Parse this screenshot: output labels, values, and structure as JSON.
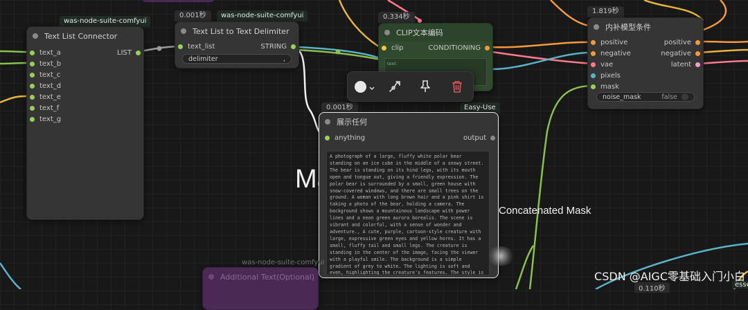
{
  "nodes": {
    "text_list_connector": {
      "suite_tag": "was-node-suite-comfyui",
      "title": "Text List Connector",
      "inputs": [
        "text_a",
        "text_b",
        "text_c",
        "text_d",
        "text_e",
        "text_f",
        "text_g"
      ],
      "output": "LIST"
    },
    "text_list_to_delimiter": {
      "time": "0.001秒",
      "suite_tag": "was-node-suite-comfyui",
      "title": "Text List to Text Delimiter",
      "input": "text_list",
      "output": "STRING",
      "widget_label": "delimiter",
      "widget_value": ","
    },
    "clip_text_encode": {
      "time": "0.334秒",
      "title": "CLIP文本编码",
      "input": "clip",
      "output": "CONDITIONING",
      "text_preview": "text"
    },
    "inpaint_conditioning": {
      "time": "1.819秒",
      "title": "内补模型条件",
      "inputs": [
        "positive",
        "negative",
        "vae",
        "pixels",
        "mask"
      ],
      "outputs": [
        "positive",
        "negative",
        "latent"
      ],
      "widget_label": "noise_mask",
      "widget_value": "false"
    },
    "show_any": {
      "time": "0.001秒",
      "suite_tag": "Easy-Use",
      "title": "展示任何",
      "input": "anything",
      "output": "output",
      "text": "A photograph of a large, fluffy white polar bear standing on an ice cube in the middle of a snowy street. The bear is standing on its hind legs, with its mouth open and tongue out, giving a friendly expression. The polar bear is surrounded by a small, green house with snow-covered windows, and there are small trees on the ground. A woman with long brown hair and a pink shirt is taking a photo of the bear, holding a camera. The background shows a mountainous landscape with power lines and a neon green aurora borealis. The scene is vibrant and colorful, with a sense of wonder and adventure., A cute, purple, cartoon-style creature with large, expressive green eyes and yellow horns. It has a small, fluffy tail and small legs. The creature is standing in the center of the image, facing the viewer with a playful smile. The background is a simple gradient of grey to white. The lighting is soft and even, highlighting the creature's features. The style is highly detailed and realistic, with a focus on smooth textures and vibrant colors."
    },
    "additional_text": {
      "suite_tag": "was-node-suite-comfyui",
      "title": "Additional Text(Optional)"
    }
  },
  "canvas_labels": {
    "ma": "Ma",
    "concatenated_mask": "Concatenated Mask",
    "bottom_time": "0.110秒",
    "edge_right": "esse"
  },
  "watermark": "CSDN @AIGC零基础入门小白",
  "toolbar_icons": [
    "color-picker-icon",
    "chevron-down-icon",
    "bypass-icon",
    "pin-icon",
    "delete-icon"
  ],
  "colors": {
    "socket_green": "#9ad05a",
    "socket_yellow": "#f5c542",
    "socket_orange": "#f59a3b",
    "socket_pink": "#ff7a8a",
    "socket_teal": "#5ab4c9",
    "delete_red": "#e25555",
    "clip_node_bg": "#2f4a2f"
  }
}
